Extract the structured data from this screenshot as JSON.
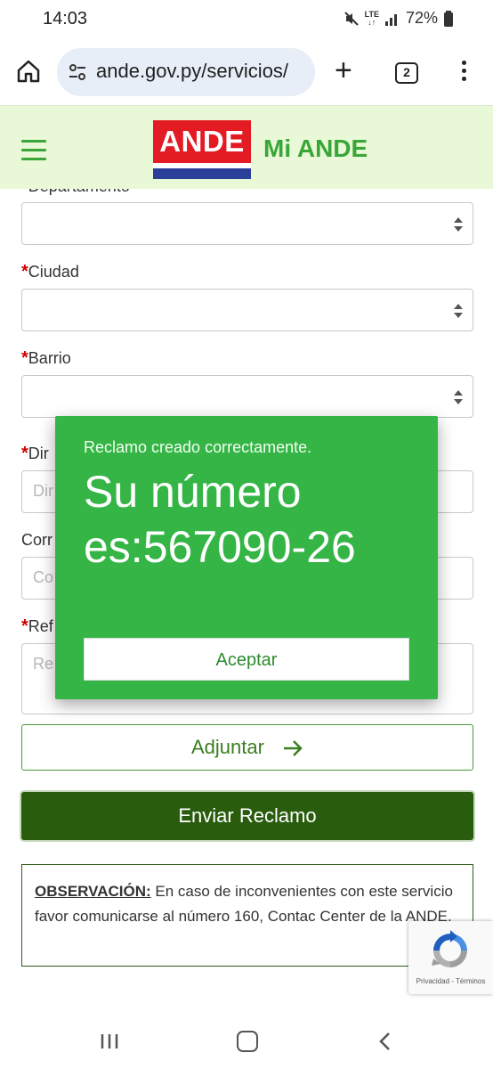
{
  "status_bar": {
    "time": "14:03",
    "network": "LTE",
    "battery": "72%"
  },
  "browser": {
    "url": "ande.gov.py/servicios/",
    "tab_count": "2"
  },
  "header": {
    "logo_text": "ANDE",
    "site_name": "Mi ANDE"
  },
  "form": {
    "departamento_label": "Departamento",
    "ciudad_label": "Ciudad",
    "barrio_label": "Barrio",
    "direccion_label_partial": "Dir",
    "direccion_placeholder_partial": "Dir",
    "correo_label_partial": "Corr",
    "correo_placeholder_partial": "Co",
    "referencia_label_partial": "Ref",
    "referencia_placeholder_partial": "Re",
    "required_mark": "*"
  },
  "buttons": {
    "adjuntar": "Adjuntar",
    "enviar": "Enviar Reclamo"
  },
  "observation": {
    "title": "OBSERVACIÓN:",
    "text": " En caso de inconvenientes con este servicio favor comunicarse al número 160, Contac Center de la ANDE."
  },
  "recaptcha": {
    "links": "Privacidad - Términos"
  },
  "dialog": {
    "message": "Reclamo creado correctamente.",
    "number_text": "Su número es:567090-26",
    "accept_button": "Aceptar"
  },
  "colors": {
    "brand_green": "#3aa63a",
    "header_bg": "#e9f8d6",
    "dialog_green": "#34b545",
    "enviar_bg": "#2a5c0d",
    "logo_red": "#e31b23",
    "logo_blue": "#2a3f97"
  }
}
